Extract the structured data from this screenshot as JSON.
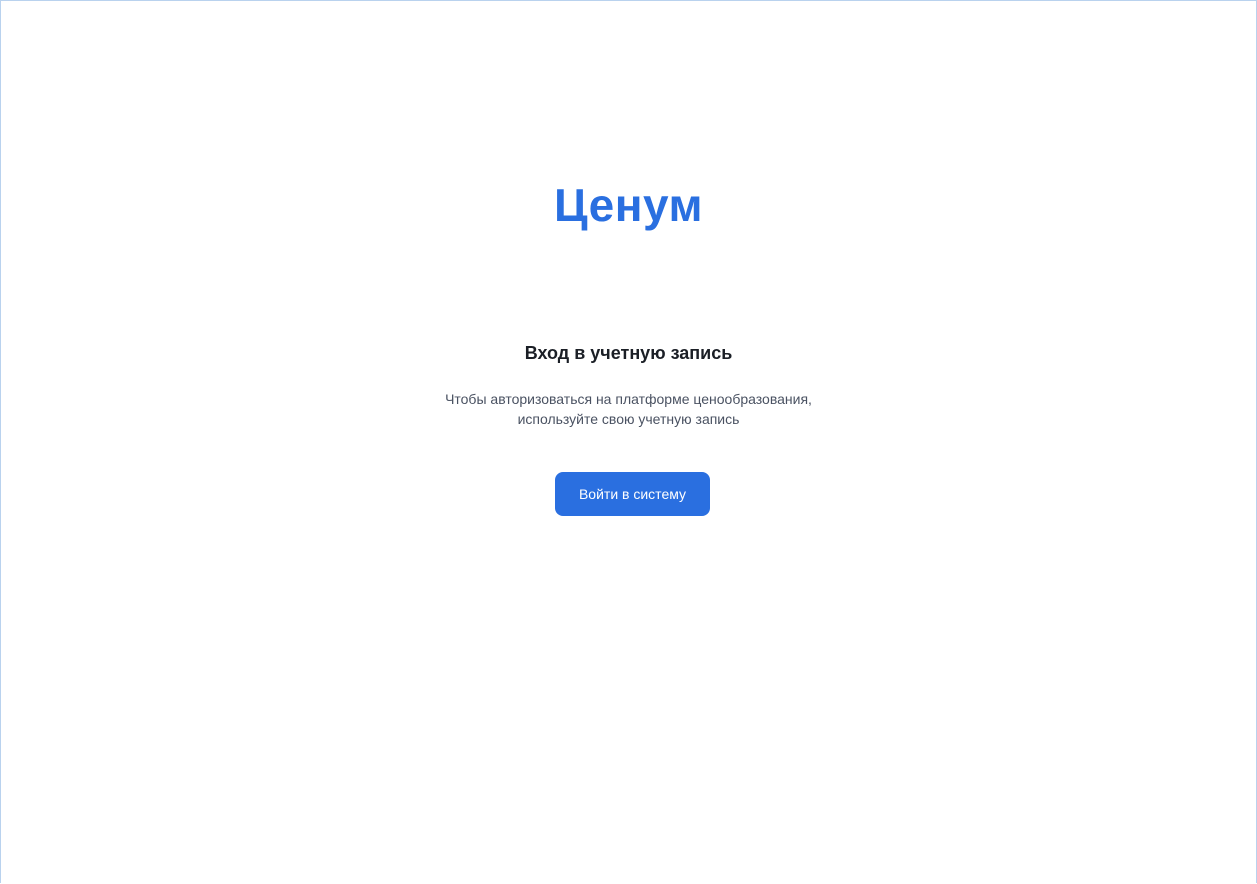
{
  "brand": {
    "logo_text": "Ценум",
    "accent_color": "#2a6fe0"
  },
  "login": {
    "title": "Вход в учетную запись",
    "subtitle_line1": "Чтобы авторизоваться на платформе ценообразования,",
    "subtitle_line2": "используйте свою учетную запись",
    "button_label": "Войти в систему"
  }
}
